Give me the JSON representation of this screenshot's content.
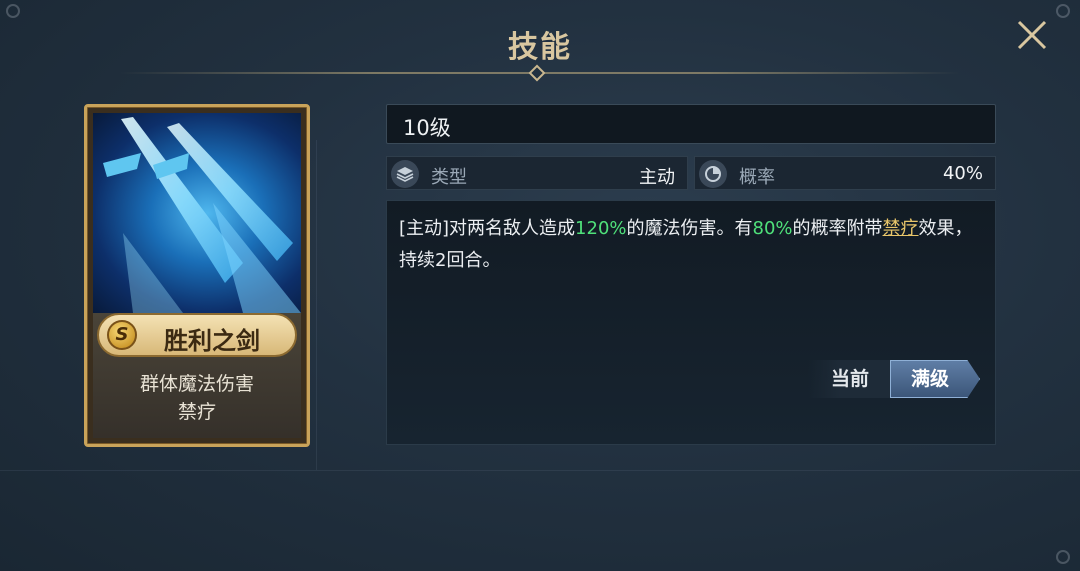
{
  "window": {
    "title": "技能",
    "close_icon": "close-icon",
    "colors": {
      "title": "#d9c7a0",
      "accent_green": "#4fe07a",
      "link_gold": "#e9c66a"
    }
  },
  "card": {
    "grade": "S",
    "name": "胜利之剑",
    "tags": [
      "群体魔法伤害",
      "禁疗"
    ],
    "art_icon": "twin-crystal-swords-art"
  },
  "detail": {
    "level": "10级",
    "stats": [
      {
        "icon": "layers-icon",
        "label": "类型",
        "value": "主动"
      },
      {
        "icon": "pie-chart-icon",
        "label": "概率",
        "value": "40%"
      }
    ],
    "description": {
      "part1": "[主动]对两名敌人造成",
      "value1": "120%",
      "part2": "的魔法伤害。有",
      "value2": "80%",
      "part3": "的概率附带",
      "link": "禁疗",
      "part4": "效果，持续2回合。"
    },
    "toggle": {
      "current": "当前",
      "max": "满级",
      "selected": "满级"
    }
  }
}
